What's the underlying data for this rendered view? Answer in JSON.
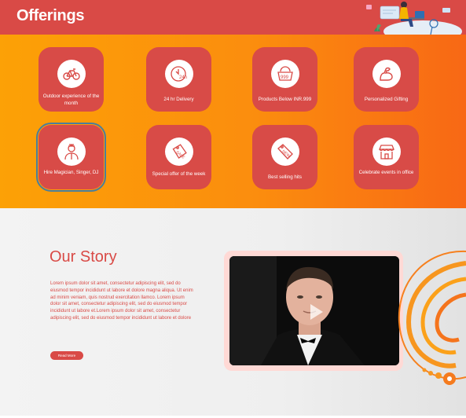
{
  "header": {
    "title": "Offerings"
  },
  "offerings": [
    {
      "label": "Outdoor experience of the month",
      "icon": "bicycle-icon"
    },
    {
      "label": "24 hr Delivery",
      "icon": "clock-24h-icon"
    },
    {
      "label": "Products Below  INR.999",
      "icon": "basket-999-icon"
    },
    {
      "label": "Personalized Gifting",
      "icon": "flexed-arm-icon"
    },
    {
      "label": "Hire Magician, Singer, DJ",
      "icon": "performer-icon"
    },
    {
      "label": "Special offer of the week",
      "icon": "sale-tag-icon"
    },
    {
      "label": "Best selling hits",
      "icon": "new-tag-icon"
    },
    {
      "label": "Celebrate events in office",
      "icon": "shop-icon"
    }
  ],
  "story": {
    "title": "Our Story",
    "body": "Lorem ipsum dolor sit amet, consectetur adipiscing elit, sed do eiusmod tempor incididunt ut labore et dolore magna aliqua. Ut enim ad minim veniam, quis nostrud exercitation llamco. Lorem ipsum dolor sit amet, consectetur adipiscing elit, sed do eiusmod tempor incididunt ut labore et.Lorem ipsum dolor sit amet, consectetur adipiscing elit, sed do eiusmod tempor incididunt ut labore et dolore",
    "button_label": "Read More"
  },
  "colors": {
    "brand_red": "#d94a46",
    "band_orange_start": "#fca106",
    "band_orange_end": "#f86815"
  }
}
